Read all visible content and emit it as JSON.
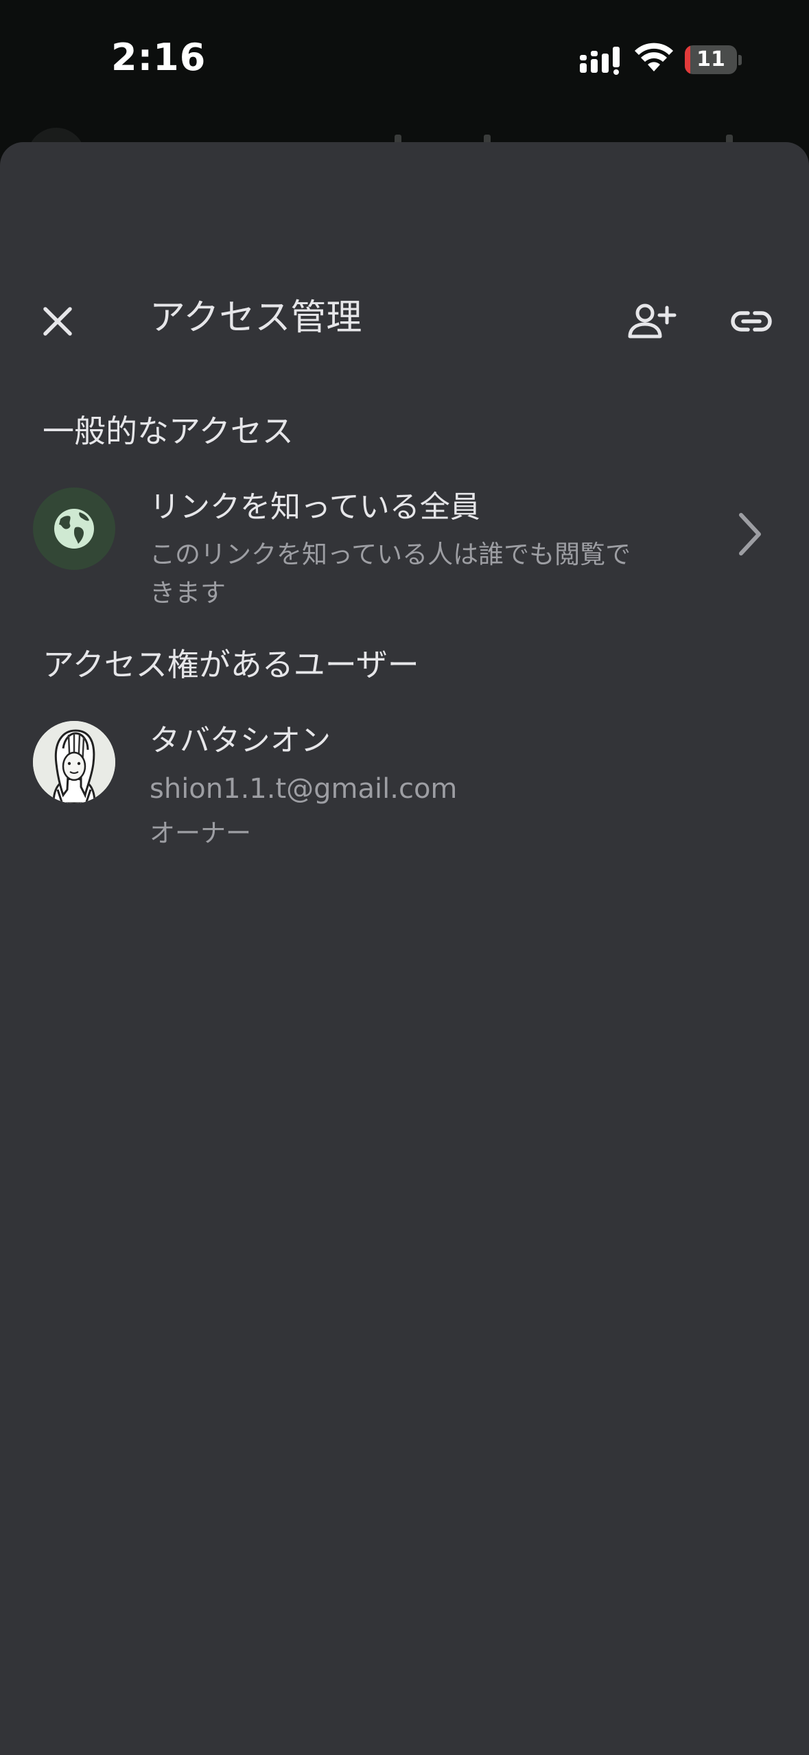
{
  "status_bar": {
    "time": "2:16",
    "battery_level": "11"
  },
  "header": {
    "title": "アクセス管理",
    "close_icon": "close-icon",
    "add_person_icon": "person-add-icon",
    "link_icon": "link-icon"
  },
  "general_access": {
    "heading": "一般的なアクセス",
    "icon": "globe-icon",
    "title": "リンクを知っている全員",
    "description": "このリンクを知っている人は誰でも閲覧できます",
    "chevron_icon": "chevron-right-icon"
  },
  "users_with_access": {
    "heading": "アクセス権があるユーザー",
    "users": [
      {
        "name": "タバタシオン",
        "email": "shion1.1.t@gmail.com",
        "role": "オーナー"
      }
    ]
  },
  "colors": {
    "sheet_background": "#333438",
    "status_background": "#0c0e0d",
    "primary_text": "#e6e6e9",
    "secondary_text": "#9d9ea3",
    "globe_circle": "#334736",
    "globe_glyph": "#cfe9d2",
    "battery_low": "#e23b3b"
  }
}
